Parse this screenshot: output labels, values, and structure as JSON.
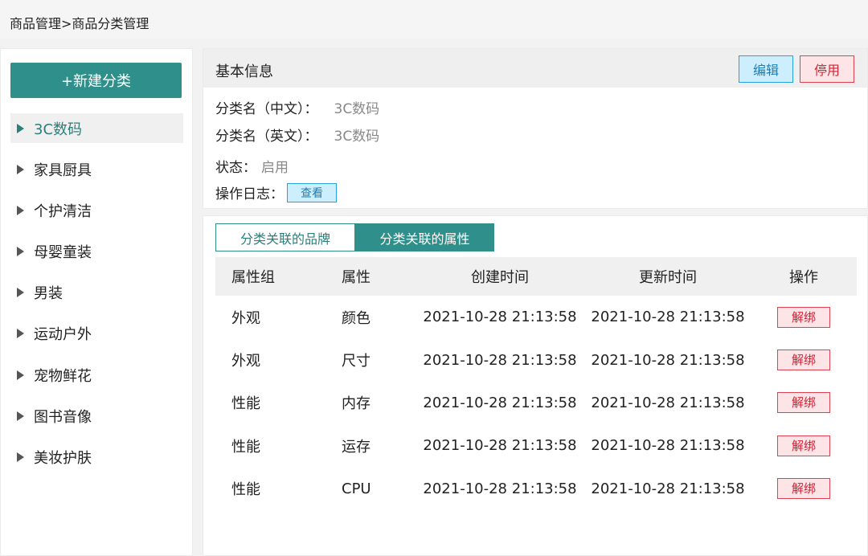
{
  "breadcrumb": "商品管理>商品分类管理",
  "sidebar": {
    "new_button": "+新建分类",
    "items": [
      {
        "label": "3C数码",
        "active": true
      },
      {
        "label": "家具厨具"
      },
      {
        "label": "个护清洁"
      },
      {
        "label": "母婴童装"
      },
      {
        "label": "男装"
      },
      {
        "label": "运动户外"
      },
      {
        "label": "宠物鲜花"
      },
      {
        "label": "图书音像"
      },
      {
        "label": "美妆护肤"
      }
    ]
  },
  "info": {
    "title": "基本信息",
    "edit_label": "编辑",
    "disable_label": "停用",
    "name_cn_label": "分类名（中文）：",
    "name_cn_value": "3C数码",
    "name_en_label": "分类名（英文）：",
    "name_en_value": "3C数码",
    "status_label": "状态：",
    "status_value": "启用",
    "log_label": "操作日志：",
    "log_button": "查看"
  },
  "tabs": {
    "brand": "分类关联的品牌",
    "attr": "分类关联的属性"
  },
  "table": {
    "headers": [
      "属性组",
      "属性",
      "创建时间",
      "更新时间",
      "操作"
    ],
    "rows": [
      {
        "group": "外观",
        "attr": "颜色",
        "created": "2021-10-28 21:13:58",
        "updated": "2021-10-28 21:13:58",
        "action": "解绑"
      },
      {
        "group": "外观",
        "attr": "尺寸",
        "created": "2021-10-28 21:13:58",
        "updated": "2021-10-28 21:13:58",
        "action": "解绑"
      },
      {
        "group": "性能",
        "attr": "内存",
        "created": "2021-10-28 21:13:58",
        "updated": "2021-10-28 21:13:58",
        "action": "解绑"
      },
      {
        "group": "性能",
        "attr": "运存",
        "created": "2021-10-28 21:13:58",
        "updated": "2021-10-28 21:13:58",
        "action": "解绑"
      },
      {
        "group": "性能",
        "attr": "CPU",
        "created": "2021-10-28 21:13:58",
        "updated": "2021-10-28 21:13:58",
        "action": "解绑"
      }
    ]
  },
  "colors": {
    "accent": "#2f8f8a",
    "danger": "#d22234",
    "info": "#1b7fb7"
  }
}
